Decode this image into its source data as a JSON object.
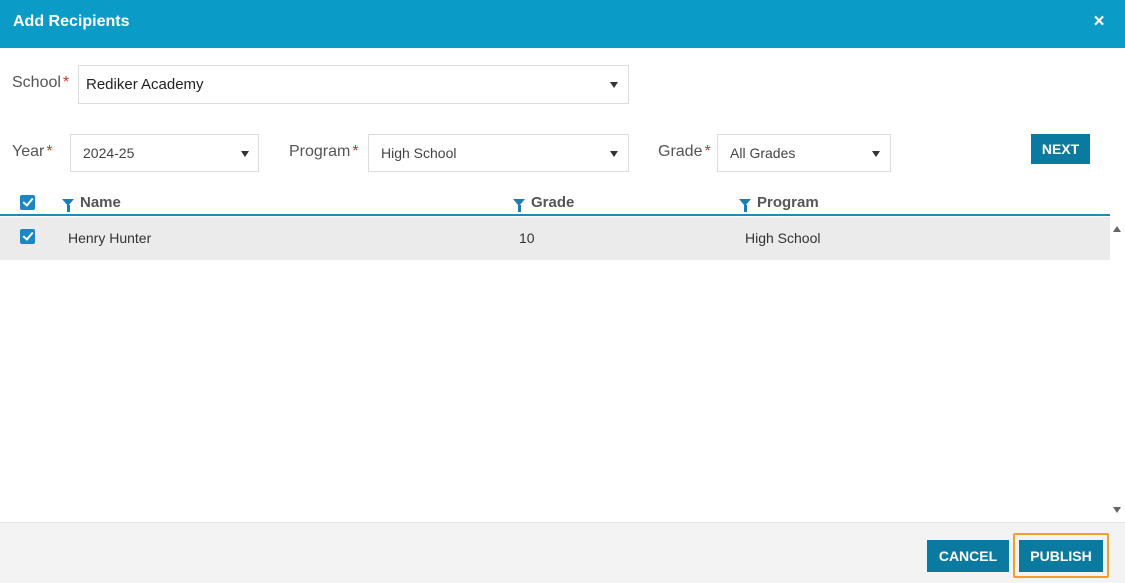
{
  "dialog": {
    "title": "Add Recipients",
    "close_icon": "×"
  },
  "filters": {
    "school": {
      "label": "School",
      "value": "Rediker Academy"
    },
    "year": {
      "label": "Year",
      "value": "2024-25"
    },
    "program": {
      "label": "Program",
      "value": "High School"
    },
    "grade": {
      "label": "Grade",
      "value": "All Grades"
    },
    "required_mark": "*",
    "next_label": "NEXT"
  },
  "grid": {
    "columns": [
      "Name",
      "Grade",
      "Program"
    ],
    "rows": [
      {
        "checked": true,
        "name": "Henry Hunter",
        "grade": "10",
        "program": "High School"
      }
    ]
  },
  "footer": {
    "cancel_label": "CANCEL",
    "publish_label": "PUBLISH"
  },
  "colors": {
    "header": "#0a9bc7",
    "button": "#0a7aa0",
    "focus_outline": "#f0a030",
    "required": "#d32f2f"
  }
}
